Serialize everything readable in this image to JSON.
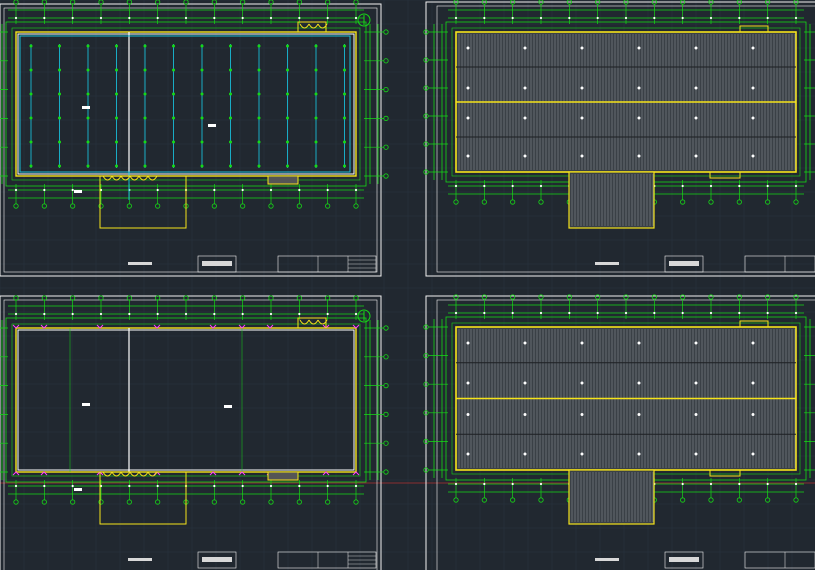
{
  "window": {
    "title": ""
  },
  "colors": {
    "background": "#212830",
    "grid": "#2b3440",
    "sheet_border": "#f2f2f2",
    "axis_line": "#16d916",
    "wall": "#f5e31a",
    "pipe": "#19bcd6",
    "roof_hatch": "#b9bec6",
    "roof_fill": "#3a4046",
    "column_mark": "#ff40ff",
    "crosshair": "#b03030"
  },
  "sheets": [
    {
      "id": "plan-top-left",
      "kind": "pipe-plan",
      "has_north_arrow": true
    },
    {
      "id": "plan-top-right",
      "kind": "roof-plan",
      "has_north_arrow": false
    },
    {
      "id": "plan-bottom-left",
      "kind": "floor-plan",
      "has_north_arrow": true
    },
    {
      "id": "plan-bottom-right",
      "kind": "roof-plan",
      "has_north_arrow": false
    }
  ],
  "icons": {
    "north_arrow": "north-arrow-icon",
    "axis_bubble": "axis-bubble-icon",
    "title_block": "title-block-icon"
  }
}
